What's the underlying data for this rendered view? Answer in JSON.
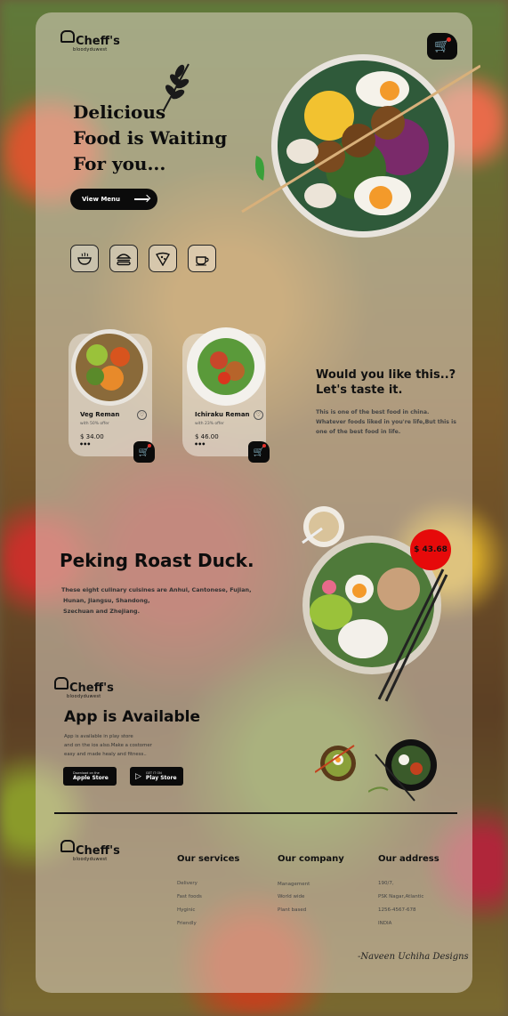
{
  "brand": {
    "name": "Cheff's",
    "tagline": "bloodyduwest"
  },
  "hero": {
    "title_lines": [
      "Delicious",
      "Food is Waiting",
      "For you..."
    ],
    "button_label": "View Menu",
    "categories": [
      "soup-bowl-icon",
      "burger-icon",
      "pizza-icon",
      "coffee-cup-icon"
    ]
  },
  "cards": [
    {
      "name": "Veg Reman",
      "offer": "with 50% offer",
      "price": "$ 34.00",
      "dots": "•••"
    },
    {
      "name": "Ichiraku Reman",
      "offer": "with 23% offer",
      "price": "$ 46.00",
      "dots": "•••"
    }
  ],
  "promo": {
    "title_line1": "Would you like this..?",
    "title_line2": "Let's taste it.",
    "text": "This is one of the best food in china. Whatever foods liked in you're life,But this is one of the best food in life."
  },
  "feature": {
    "title": "Peking Roast Duck.",
    "text_lines": [
      "These eight culinary cuisines are Anhui, Cantonese, Fujian,",
      "Hunan, Jiangsu, Shandong,",
      "Szechuan and Zhejiang."
    ],
    "price": "$ 43.68"
  },
  "app": {
    "title": "App is Available",
    "text_lines": [
      "App is available in play store",
      "and on the ios also.Make a costomer",
      "easy and made healy and fitness.."
    ],
    "apple": {
      "small": "Download on the",
      "big": "Apple Store"
    },
    "play": {
      "small": "GET IT ON",
      "big": "Play Store"
    }
  },
  "footer": {
    "services": {
      "heading": "Our services",
      "items": [
        "Delivery",
        "Fast foods",
        "Hyginic",
        "Friendly"
      ]
    },
    "company": {
      "heading": "Our company",
      "items": [
        "Management",
        "World wide",
        "Plant based"
      ]
    },
    "address": {
      "heading": "Our address",
      "items": [
        "190/7,",
        "PSK Nagar,Atlantic",
        "1256-4567-678",
        "INDIA"
      ]
    },
    "signature": "-Naveen Uchiha Designs"
  },
  "colors": {
    "accent_red": "#e60a0a",
    "button_black": "#0b0b0b"
  }
}
